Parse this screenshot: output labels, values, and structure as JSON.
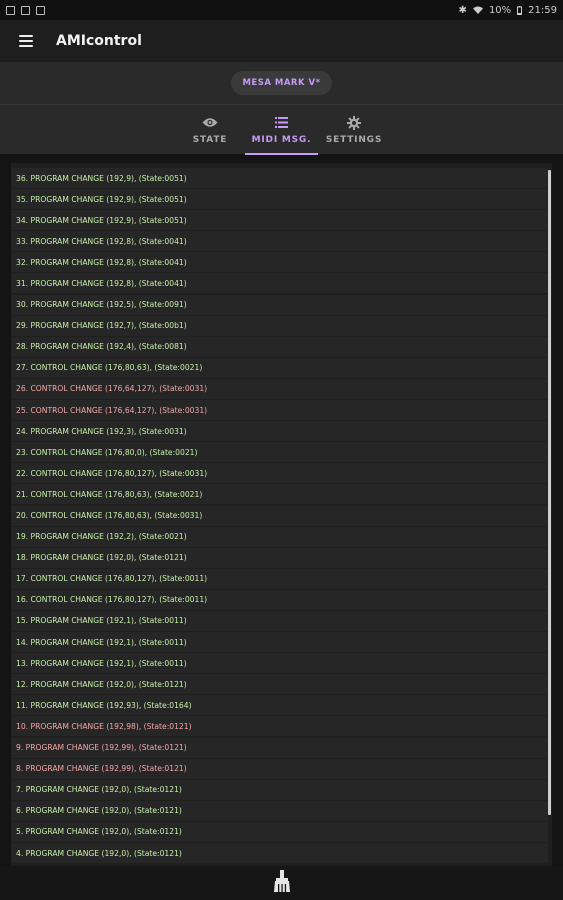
{
  "statusbar": {
    "battery": "10%",
    "time": "21:59"
  },
  "appbar": {
    "title": "AMIcontrol"
  },
  "device": {
    "label": "MESA MARK V*"
  },
  "tabs": [
    {
      "label": "STATE",
      "icon": "eye-icon"
    },
    {
      "label": "MIDI MSG.",
      "icon": "list-icon"
    },
    {
      "label": "SETTINGS",
      "icon": "gear-icon"
    }
  ],
  "colors": {
    "accent": "#c49bf5",
    "message_green": "#c7f0ab",
    "message_red": "#f2a7a7"
  },
  "messages": [
    {
      "text": "36. PROGRAM CHANGE (192,9), (State:0051)",
      "color": "green"
    },
    {
      "text": "35. PROGRAM CHANGE (192,9), (State:0051)",
      "color": "green"
    },
    {
      "text": "34. PROGRAM CHANGE (192,9), (State:0051)",
      "color": "green"
    },
    {
      "text": "33. PROGRAM CHANGE (192,8), (State:0041)",
      "color": "green"
    },
    {
      "text": "32. PROGRAM CHANGE (192,8), (State:0041)",
      "color": "green"
    },
    {
      "text": "31. PROGRAM CHANGE (192,8), (State:0041)",
      "color": "green"
    },
    {
      "text": "30. PROGRAM CHANGE (192,5), (State:0091)",
      "color": "green"
    },
    {
      "text": "29. PROGRAM CHANGE (192,7), (State:00b1)",
      "color": "green"
    },
    {
      "text": "28. PROGRAM CHANGE (192,4), (State:0081)",
      "color": "green"
    },
    {
      "text": "27. CONTROL CHANGE (176,80,63), (State:0021)",
      "color": "green"
    },
    {
      "text": "26. CONTROL CHANGE (176,64,127), (State:0031)",
      "color": "red"
    },
    {
      "text": "25. CONTROL CHANGE (176,64,127), (State:0031)",
      "color": "red"
    },
    {
      "text": "24. PROGRAM CHANGE (192,3), (State:0031)",
      "color": "green"
    },
    {
      "text": "23. CONTROL CHANGE (176,80,0), (State:0021)",
      "color": "green"
    },
    {
      "text": "22. CONTROL CHANGE (176,80,127), (State:0031)",
      "color": "green"
    },
    {
      "text": "21. CONTROL CHANGE (176,80,63), (State:0021)",
      "color": "green"
    },
    {
      "text": "20. CONTROL CHANGE (176,80,63), (State:0031)",
      "color": "green"
    },
    {
      "text": "19. PROGRAM CHANGE (192,2), (State:0021)",
      "color": "green"
    },
    {
      "text": "18. PROGRAM CHANGE (192,0), (State:0121)",
      "color": "green"
    },
    {
      "text": "17. CONTROL CHANGE (176,80,127), (State:0011)",
      "color": "green"
    },
    {
      "text": "16. CONTROL CHANGE (176,80,127), (State:0011)",
      "color": "green"
    },
    {
      "text": "15. PROGRAM CHANGE (192,1), (State:0011)",
      "color": "green"
    },
    {
      "text": "14. PROGRAM CHANGE (192,1), (State:0011)",
      "color": "green"
    },
    {
      "text": "13. PROGRAM CHANGE (192,1), (State:0011)",
      "color": "green"
    },
    {
      "text": "12. PROGRAM CHANGE (192,0), (State:0121)",
      "color": "green"
    },
    {
      "text": "11. PROGRAM CHANGE (192,93), (State:0164)",
      "color": "green"
    },
    {
      "text": "10. PROGRAM CHANGE (192,98), (State:0121)",
      "color": "red"
    },
    {
      "text": "9. PROGRAM CHANGE (192,99), (State:0121)",
      "color": "red"
    },
    {
      "text": "8. PROGRAM CHANGE (192,99), (State:0121)",
      "color": "red"
    },
    {
      "text": "7. PROGRAM CHANGE (192,0), (State:0121)",
      "color": "green"
    },
    {
      "text": "6. PROGRAM CHANGE (192,0), (State:0121)",
      "color": "green"
    },
    {
      "text": "5. PROGRAM CHANGE (192,0), (State:0121)",
      "color": "green"
    },
    {
      "text": "4. PROGRAM CHANGE (192,0), (State:0121)",
      "color": "green"
    }
  ],
  "bottom_action": {
    "icon": "broom-icon"
  }
}
